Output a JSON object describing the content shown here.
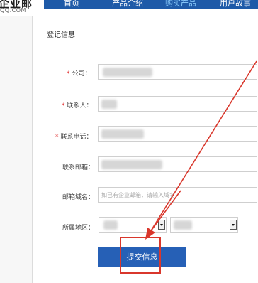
{
  "logo": {
    "main": "企业邮",
    "sub": "QQ.COM"
  },
  "nav": {
    "items": [
      "首页",
      "产品介绍",
      "购买产品",
      "用户故事"
    ],
    "active_index": 2
  },
  "form": {
    "title": "登记信息",
    "fields": {
      "company": {
        "label": "公司：",
        "required": true
      },
      "contact": {
        "label": "联系人：",
        "required": true
      },
      "phone": {
        "label": "联系电话：",
        "required": true
      },
      "email": {
        "label": "联系邮箱：",
        "required": false
      },
      "domain": {
        "label": "邮箱域名：",
        "required": false,
        "placeholder": "如已有企业邮箱，请输入域名"
      },
      "region": {
        "label": "所属地区：",
        "required": false
      }
    },
    "required_mark": "*",
    "submit_label": "提交信息"
  },
  "colors": {
    "nav_bar": "#1e5aa8",
    "nav_active": "#8fd0ff",
    "submit_button": "#2660b6",
    "required_mark": "#e23b3b",
    "annotation": "#d9372c"
  }
}
